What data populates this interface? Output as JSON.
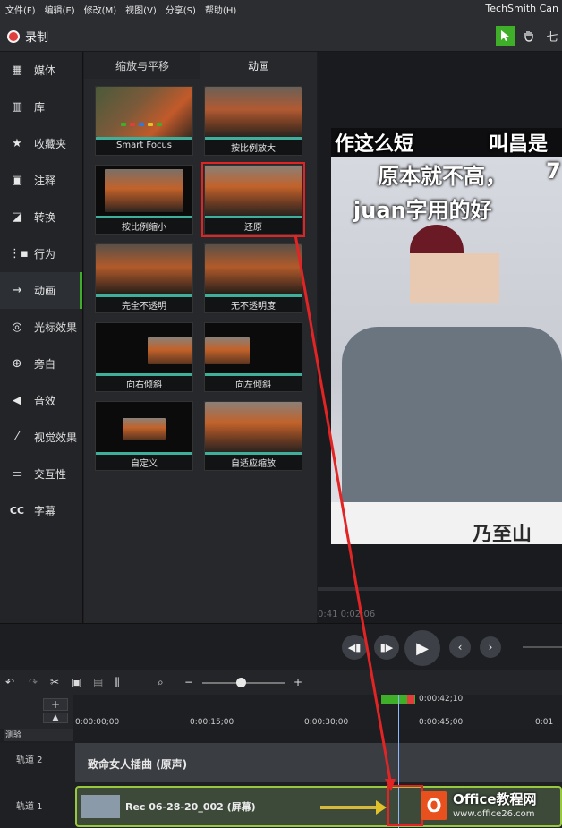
{
  "menu": [
    "文件(F)",
    "编辑(E)",
    "修改(M)",
    "视图(V)",
    "分享(S)",
    "帮助(H)"
  ],
  "brand": "TechSmith Can",
  "record_label": "录制",
  "toolbar_text": "七",
  "sidebar": [
    {
      "label": "媒体",
      "icon": "media-icon"
    },
    {
      "label": "库",
      "icon": "library-icon"
    },
    {
      "label": "收藏夹",
      "icon": "star-icon"
    },
    {
      "label": "注释",
      "icon": "annotation-icon"
    },
    {
      "label": "转换",
      "icon": "transition-icon"
    },
    {
      "label": "行为",
      "icon": "behavior-icon"
    },
    {
      "label": "动画",
      "icon": "animation-icon",
      "active": true
    },
    {
      "label": "光标效果",
      "icon": "cursor-icon"
    },
    {
      "label": "旁白",
      "icon": "mic-icon"
    },
    {
      "label": "音效",
      "icon": "audio-icon"
    },
    {
      "label": "视觉效果",
      "icon": "wand-icon"
    },
    {
      "label": "交互性",
      "icon": "interactive-icon"
    },
    {
      "label": "字幕",
      "icon": "cc-icon"
    }
  ],
  "tabs": [
    "缩放与平移",
    "动画"
  ],
  "animations": [
    {
      "label": "Smart Focus",
      "style": "full"
    },
    {
      "label": "按比例放大",
      "style": "full"
    },
    {
      "label": "按比例缩小",
      "style": "inset"
    },
    {
      "label": "还原",
      "style": "full",
      "selected": true
    },
    {
      "label": "完全不透明",
      "style": "full"
    },
    {
      "label": "无不透明度",
      "style": "full"
    },
    {
      "label": "向右倾斜",
      "style": "right"
    },
    {
      "label": "向左倾斜",
      "style": "left"
    },
    {
      "label": "自定义",
      "style": "small"
    },
    {
      "label": "自适应缩放",
      "style": "full"
    }
  ],
  "video_text": {
    "line1": "作这么短",
    "line1b": "叫昌是",
    "line2": "原本就不高，",
    "line2b": "7",
    "line3": "juan字用的好",
    "bottom": "乃至山"
  },
  "canvas_time": "0:41  0:02:06",
  "timeline": {
    "playhead_time": "0:00:42;10",
    "ticks": [
      "0:00:00;00",
      "0:00:15;00",
      "0:00:30;00",
      "0:00:45;00",
      "0:01"
    ],
    "track_label_left": "测验",
    "tracks": [
      {
        "name": "轨道 2",
        "clip": "致命女人插曲 (原声)"
      },
      {
        "name": "轨道 1",
        "clip": "Rec 06-28-20_002 (屏幕)"
      }
    ]
  },
  "watermark": {
    "title": "Office教程网",
    "url": "www.office26.com"
  },
  "colors": {
    "accent": "#3fae29",
    "highlight": "#e02424",
    "selection_bar": "#3fae9a"
  }
}
